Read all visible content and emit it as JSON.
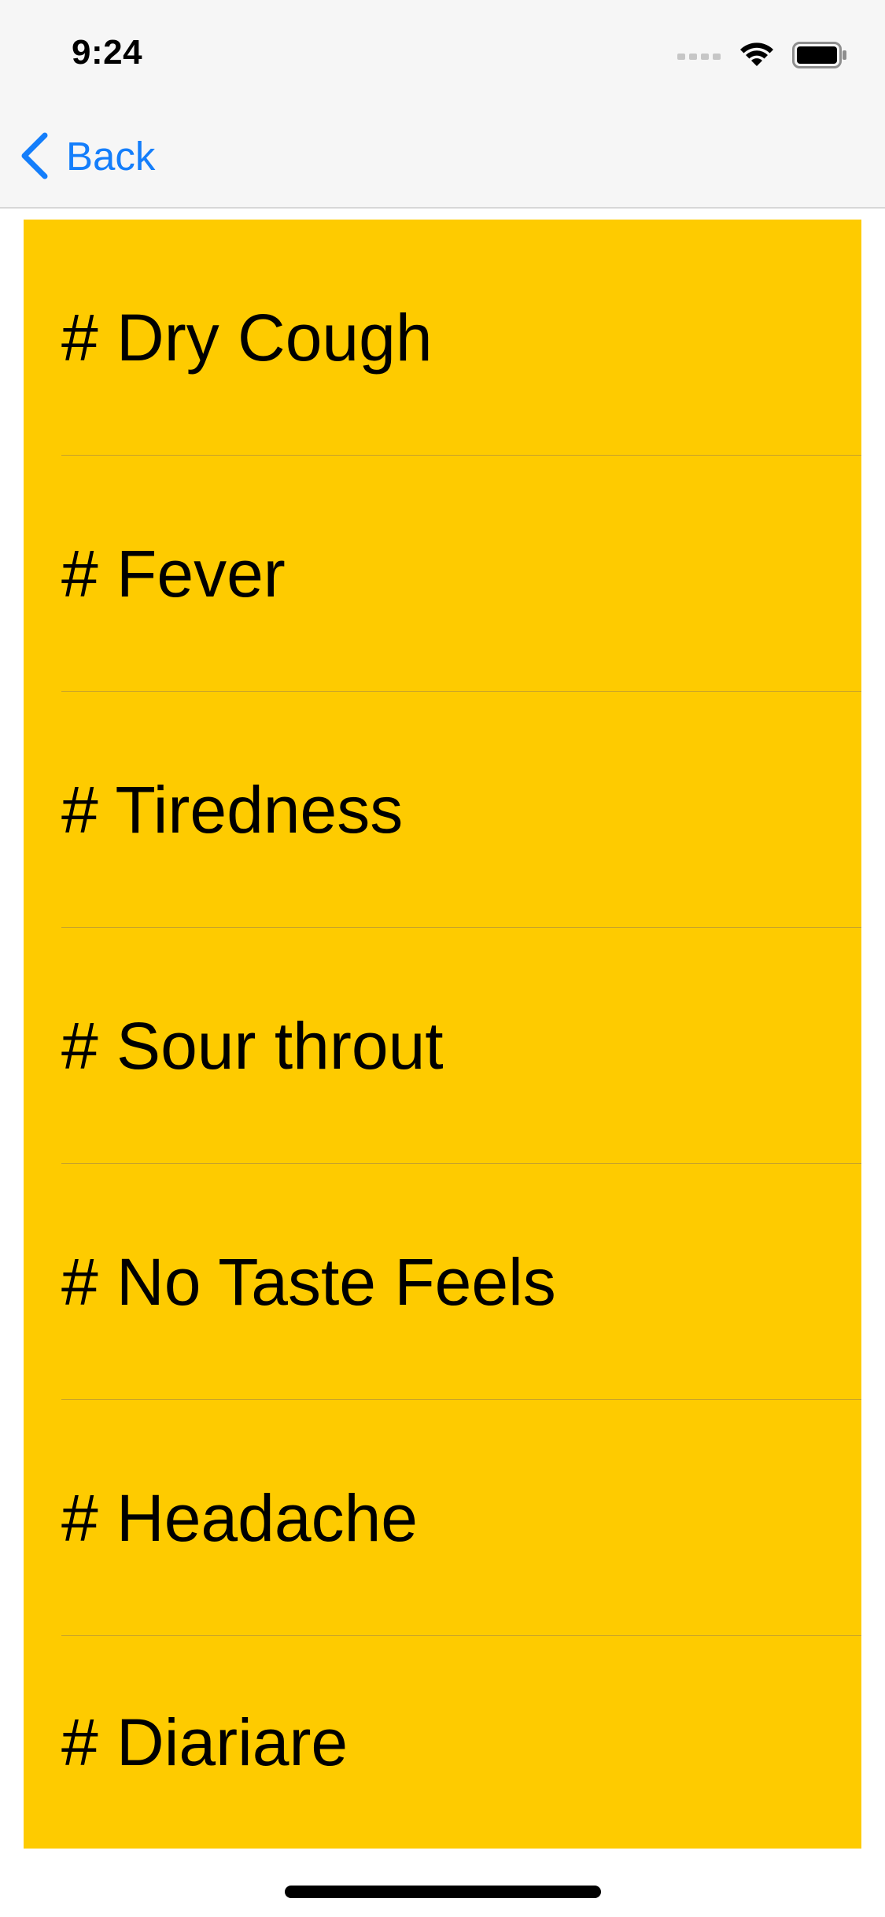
{
  "status_bar": {
    "time": "9:24",
    "icons": [
      "signal-icon",
      "wifi-icon",
      "battery-icon"
    ]
  },
  "nav": {
    "back_label": "Back",
    "back_icon": "chevron-left-icon",
    "accent_color": "#147efb"
  },
  "list": {
    "background_color": "#fecb00",
    "items": [
      {
        "label": "# Dry Cough"
      },
      {
        "label": "# Fever"
      },
      {
        "label": "# Tiredness"
      },
      {
        "label": "# Sour throut"
      },
      {
        "label": "# No Taste Feels"
      },
      {
        "label": "# Headache"
      },
      {
        "label": "# Diariare"
      }
    ]
  }
}
